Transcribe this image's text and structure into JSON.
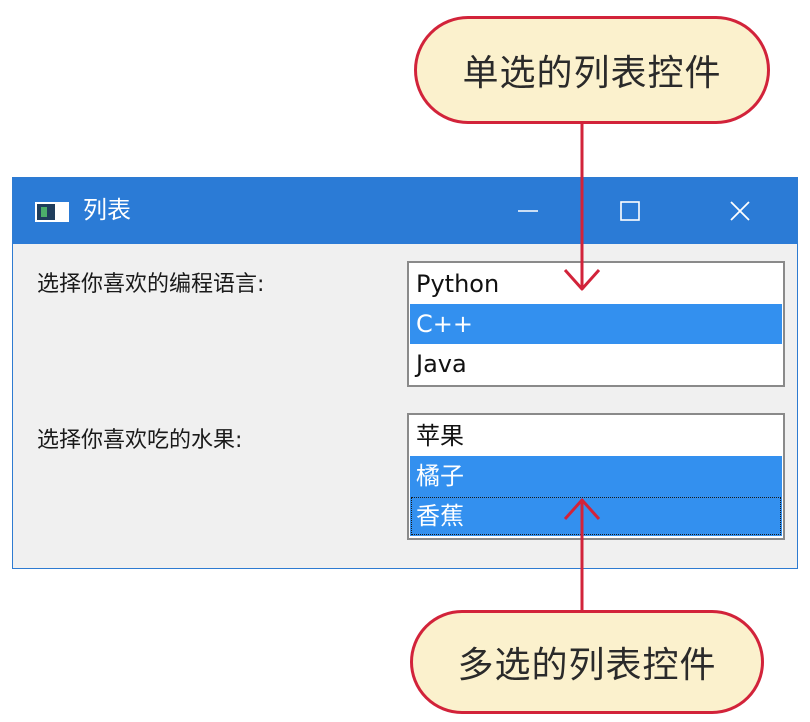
{
  "callouts": {
    "single_select": "单选的列表控件",
    "multi_select": "多选的列表控件"
  },
  "window": {
    "title": "列表",
    "icon": "app-window-icon",
    "controls": {
      "minimize": "minimize-icon",
      "maximize": "maximize-icon",
      "close": "close-icon"
    }
  },
  "language": {
    "label": "选择你喜欢的编程语言:",
    "selection_mode": "single",
    "items": [
      {
        "text": "Python",
        "selected": false
      },
      {
        "text": "C++",
        "selected": true
      },
      {
        "text": "Java",
        "selected": false
      }
    ]
  },
  "fruit": {
    "label": "选择你喜欢吃的水果:",
    "selection_mode": "multiple",
    "items": [
      {
        "text": "苹果",
        "selected": false
      },
      {
        "text": "橘子",
        "selected": true
      },
      {
        "text": "香蕉",
        "selected": true
      }
    ]
  },
  "colors": {
    "titlebar": "#2b7bd6",
    "selection": "#3390ef",
    "callout_border": "#d2233a",
    "callout_fill": "#fbf1cd",
    "arrow": "#d2233a"
  }
}
